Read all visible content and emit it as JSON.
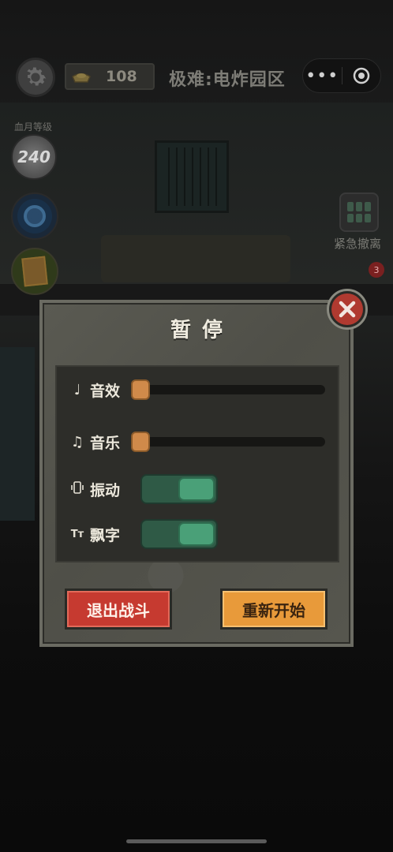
{
  "topbar": {
    "gold_count": "108",
    "level_title": "极难:电炸园区",
    "more_glyph": "•••"
  },
  "left": {
    "blood_label": "血月等级",
    "blood_level": "240"
  },
  "right": {
    "evac_label": "紧急撤离",
    "badge_count": "3"
  },
  "dialog": {
    "title": "暂停",
    "settings": {
      "sound_label": "音效",
      "sound_level": 0,
      "music_label": "音乐",
      "music_level": 0,
      "vibration_label": "振动",
      "vibration_on": true,
      "floating_text_label": "飘字",
      "floating_text_on": true
    },
    "exit_label": "退出战斗",
    "restart_label": "重新开始"
  },
  "colors": {
    "exit_button": "#c63a30",
    "restart_button": "#e89a3a",
    "toggle_on": "#4aa078",
    "slider_knob": "#d08a4a",
    "close_button": "#b03a30"
  }
}
